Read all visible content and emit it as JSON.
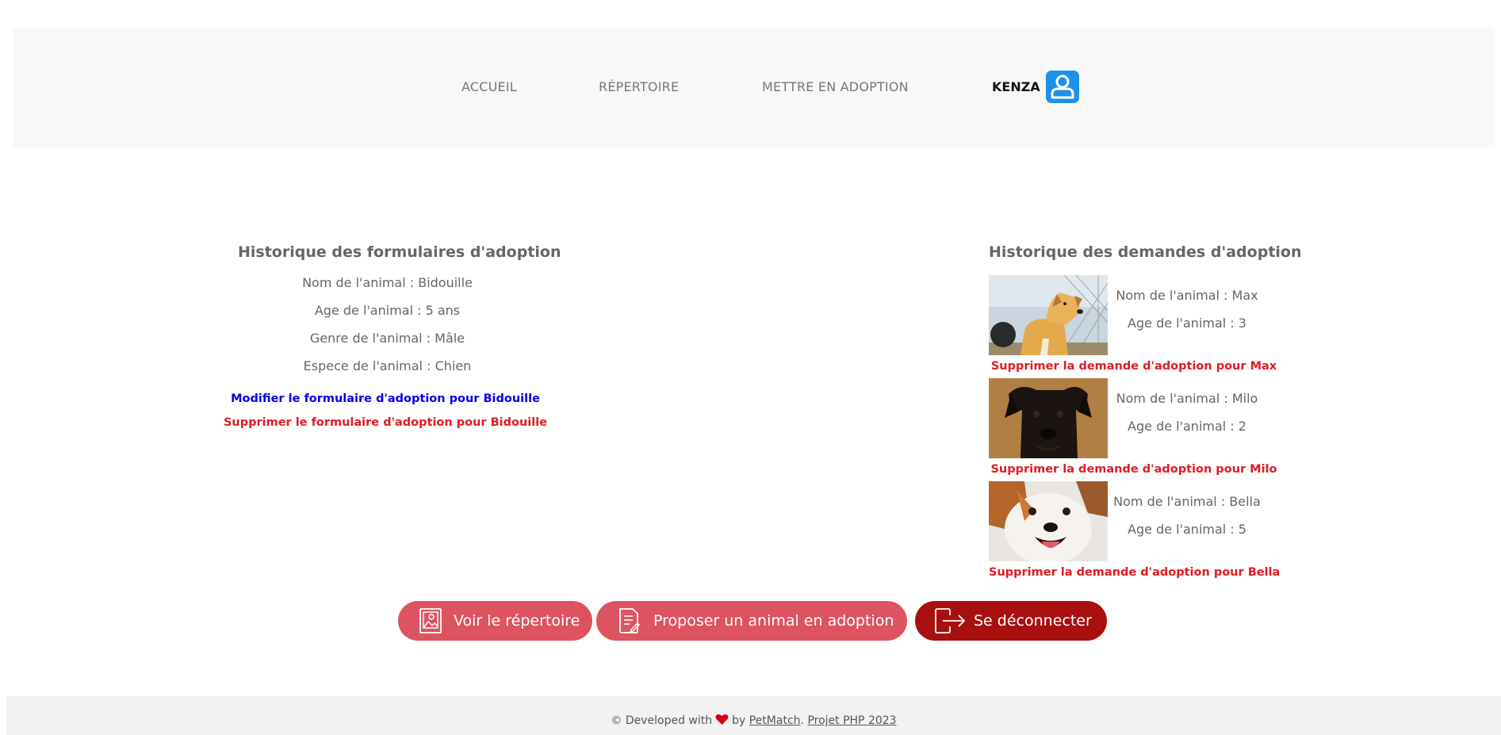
{
  "nav": {
    "links": [
      "ACCUEIL",
      "RÉPERTOIRE",
      "METTRE EN ADOPTION"
    ],
    "user_name": "KENZA",
    "user_icon": "user-profile-icon"
  },
  "forms_history": {
    "title": "Historique des formulaires d'adoption",
    "pet_name": "Nom de l'animal : Bidouille",
    "pet_age": "Age de l'animal : 5 ans",
    "pet_gender": "Genre de l'animal : Mâle",
    "pet_species": "Espece de l'animal : Chien",
    "edit_link": "Modifier le formulaire d'adoption pour Bidouille",
    "delete_link": "Supprimer le formulaire d'adoption pour Bidouille"
  },
  "requests_history": {
    "title": "Historique des demandes d'adoption",
    "requests": [
      {
        "name": "Nom de l'animal : Max",
        "age": "Age de l'animal : 3",
        "delete_link": "Supprimer la demande d'adoption pour Max"
      },
      {
        "name": "Nom de l'animal : Milo",
        "age": "Age de l'animal : 2",
        "delete_link": "Supprimer la demande d'adoption pour Milo"
      },
      {
        "name": "Nom de l'animal : Bella",
        "age": "Age de l'animal : 5",
        "delete_link": "Supprimer la demande d'adoption pour Bella"
      }
    ]
  },
  "actions": {
    "view_directory": "Voir le répertoire",
    "propose_animal": "Proposer un animal en adoption",
    "logout": "Se déconnecter"
  },
  "colors": {
    "nav_background": "#f8f8f8",
    "user_icon": "#1e90e8",
    "edit_link": "#0000ee",
    "delete_link": "#e01b24",
    "button_primary": "#dd5361",
    "button_logout": "#a80f0f",
    "footer_background": "#f2f2f2"
  },
  "footer": {
    "prefix": "© Developed with",
    "by": "by",
    "brand_link": "PetMatch",
    "separator": ".",
    "project_link": "Projet PHP 2023"
  }
}
